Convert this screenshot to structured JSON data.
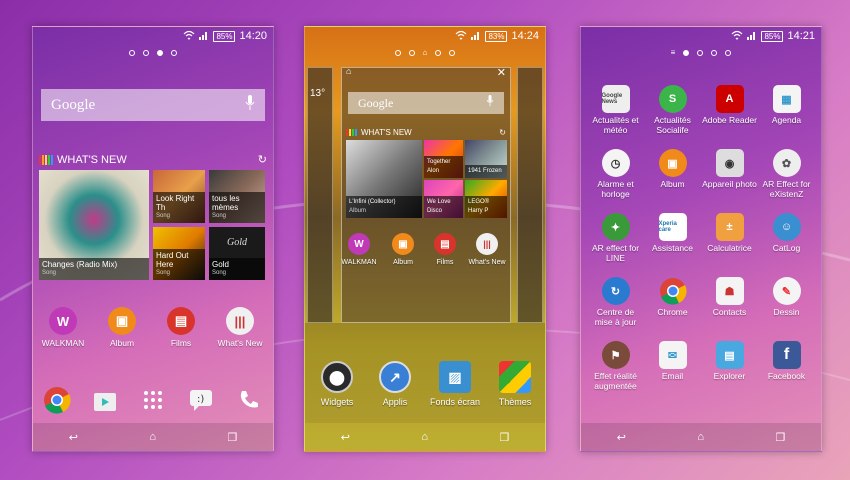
{
  "status": {
    "screen1": {
      "battery": "85%",
      "time": "14:20"
    },
    "screen2": {
      "battery": "83%",
      "time": "14:24"
    },
    "screen3": {
      "battery": "85%",
      "time": "14:21"
    }
  },
  "google_label": "Google",
  "whats_new_label": "WHAT'S NEW",
  "screen1": {
    "tiles": [
      {
        "title": "Changes (Radio Mix)",
        "sub": "Song"
      },
      {
        "title": "Look Right Th",
        "sub": "Song"
      },
      {
        "title": "tous les mèmes",
        "sub": "Song"
      },
      {
        "title": "Hard Out Here",
        "sub": "Song"
      },
      {
        "title": "Gold",
        "sub": "Song"
      }
    ],
    "apps": [
      "WALKMAN",
      "Album",
      "Films",
      "What's New"
    ],
    "tile_bg_text": "Gold"
  },
  "screen2": {
    "tiles": [
      {
        "title": "L'Infini (Collector)",
        "sub": "Album"
      },
      {
        "title": "Together Alon",
        "sub": "Song"
      },
      {
        "title": "1941 Frozen",
        "sub": "Song"
      },
      {
        "title": "We Love Disco",
        "sub": "Song"
      },
      {
        "title": "LEGO® Harry P",
        "sub": "Game"
      }
    ],
    "apps": [
      "WALKMAN",
      "Album",
      "Films",
      "What's New"
    ],
    "side_number": "13°",
    "options": [
      "Widgets",
      "Applis",
      "Fonds écran",
      "Thèmes"
    ]
  },
  "screen3": {
    "apps": [
      "Actualités et météo",
      "Actualités Socialife",
      "Adobe Reader",
      "Agenda",
      "Alarme et horloge",
      "Album",
      "Appareil photo",
      "AR Effect for eXistenZ",
      "AR effect for LINE",
      "Assistance",
      "Calculatrice",
      "CatLog",
      "Centre de mise à jour",
      "Chrome",
      "Contacts",
      "Dessin",
      "Effet réalité augmentée",
      "Email",
      "Explorer",
      "Facebook"
    ],
    "icon_text": {
      "news": "Google News",
      "socialife": "S",
      "adobe": "A",
      "xperia": "Xperia care",
      "facebook": "f"
    }
  },
  "colors": {
    "walkman": "#c03ab8",
    "album": "#f08a1a",
    "films": "#d9342b",
    "chrome_red": "#db4437",
    "chrome_green": "#0f9d58",
    "chrome_yellow": "#f4b400",
    "chrome_blue": "#4285f4"
  }
}
